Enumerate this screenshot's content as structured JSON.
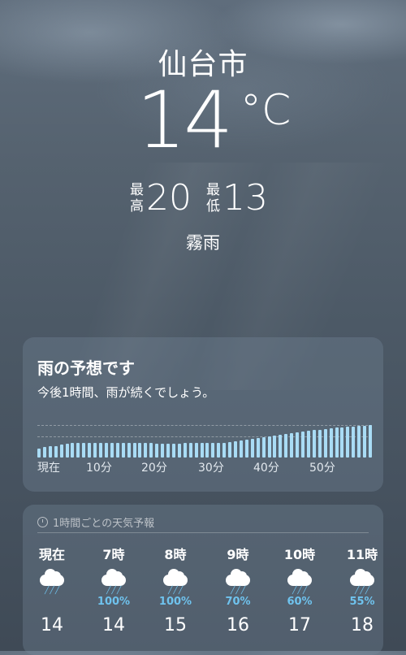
{
  "current": {
    "city": "仙台市",
    "temperature": "14",
    "unit": "°C",
    "high_label_1": "最",
    "high_label_2": "高",
    "high": "20",
    "low_label_1": "最",
    "low_label_2": "低",
    "low": "13",
    "condition": "霧雨"
  },
  "rain_forecast": {
    "title": "雨の予想です",
    "subtitle": "今後1時間、雨が続くでしょう。",
    "ticks": [
      "現在",
      "10分",
      "20分",
      "30分",
      "40分",
      "50分"
    ],
    "intensity": [
      0.28,
      0.32,
      0.34,
      0.36,
      0.4,
      0.42,
      0.44,
      0.45,
      0.45,
      0.45,
      0.46,
      0.45,
      0.45,
      0.45,
      0.44,
      0.44,
      0.45,
      0.44,
      0.44,
      0.44,
      0.44,
      0.43,
      0.43,
      0.43,
      0.43,
      0.43,
      0.44,
      0.44,
      0.44,
      0.44,
      0.44,
      0.45,
      0.45,
      0.46,
      0.48,
      0.5,
      0.52,
      0.55,
      0.58,
      0.6,
      0.62,
      0.65,
      0.68,
      0.7,
      0.72,
      0.75,
      0.77,
      0.8,
      0.82,
      0.84,
      0.86,
      0.88,
      0.9,
      0.92,
      0.93,
      0.95,
      0.96,
      0.97,
      0.98,
      0.99
    ]
  },
  "hourly": {
    "header": "1時間ごとの天気予報",
    "items": [
      {
        "time": "現在",
        "icon": "rain-cloud-icon",
        "precip": "",
        "temp": "14"
      },
      {
        "time": "7時",
        "icon": "rain-cloud-icon",
        "precip": "100%",
        "temp": "14"
      },
      {
        "time": "8時",
        "icon": "rain-cloud-icon",
        "precip": "100%",
        "temp": "15"
      },
      {
        "time": "9時",
        "icon": "rain-cloud-icon",
        "precip": "70%",
        "temp": "16"
      },
      {
        "time": "10時",
        "icon": "rain-cloud-icon",
        "precip": "60%",
        "temp": "17"
      },
      {
        "time": "11時",
        "icon": "rain-cloud-icon",
        "precip": "55%",
        "temp": "18"
      }
    ]
  },
  "colors": {
    "precip": "#6fc3ee",
    "bar": "#a9dcf5"
  }
}
